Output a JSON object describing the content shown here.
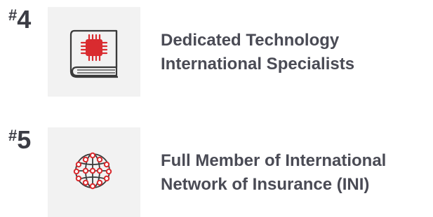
{
  "colors": {
    "text": "#4a4b55",
    "rank": "#3b3c44",
    "accent": "#d92b2f",
    "tile": "#f2f2f2",
    "icon_stroke": "#3a3a3a"
  },
  "items": [
    {
      "rank_hash": "#",
      "rank_num": "4",
      "icon": "chip-book-icon",
      "line1": "Dedicated Technology",
      "line2": "International Specialists"
    },
    {
      "rank_hash": "#",
      "rank_num": "5",
      "icon": "network-globe-icon",
      "line1": "Full Member of International",
      "line2": "Network of Insurance (INI)"
    }
  ]
}
